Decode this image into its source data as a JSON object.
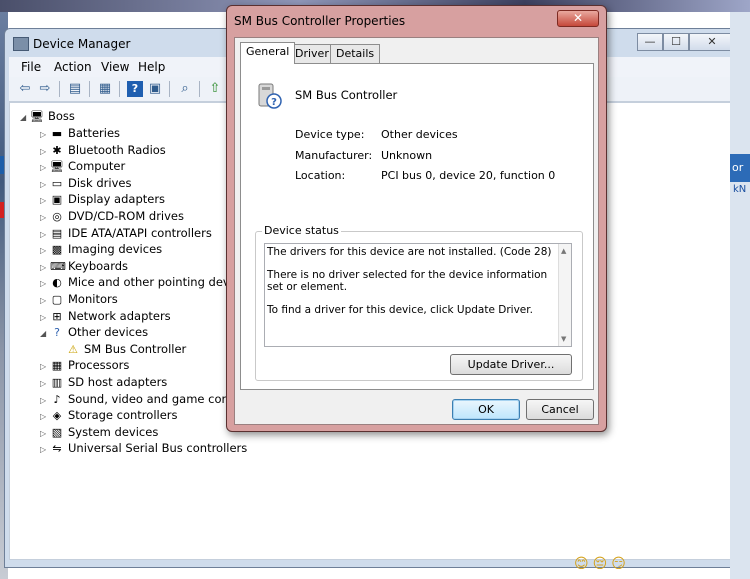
{
  "device_manager": {
    "title": "Device Manager",
    "controls": {
      "minimize": "—",
      "maximize": "☐",
      "close": "✕"
    },
    "menu": [
      "File",
      "Action",
      "View",
      "Help"
    ],
    "root": "Boss",
    "categories": [
      {
        "label": "Batteries",
        "icon": "battery-icon",
        "glyph": "▬"
      },
      {
        "label": "Bluetooth Radios",
        "icon": "bluetooth-icon",
        "glyph": "✱"
      },
      {
        "label": "Computer",
        "icon": "computer-icon",
        "glyph": "🖥"
      },
      {
        "label": "Disk drives",
        "icon": "disk-drive-icon",
        "glyph": "▭"
      },
      {
        "label": "Display adapters",
        "icon": "display-adapter-icon",
        "glyph": "▣"
      },
      {
        "label": "DVD/CD-ROM drives",
        "icon": "dvd-drive-icon",
        "glyph": "◎"
      },
      {
        "label": "IDE ATA/ATAPI controllers",
        "icon": "ide-controller-icon",
        "glyph": "▤"
      },
      {
        "label": "Imaging devices",
        "icon": "camera-icon",
        "glyph": "▩"
      },
      {
        "label": "Keyboards",
        "icon": "keyboard-icon",
        "glyph": "⌨"
      },
      {
        "label": "Mice and other pointing devices",
        "icon": "mouse-icon",
        "glyph": "◐"
      },
      {
        "label": "Monitors",
        "icon": "monitor-icon",
        "glyph": "▢"
      },
      {
        "label": "Network adapters",
        "icon": "network-adapter-icon",
        "glyph": "⊞"
      },
      {
        "label": "Other devices",
        "icon": "unknown-device-icon",
        "glyph": "?"
      },
      {
        "label": "SM Bus Controller",
        "icon": "warning-device-icon",
        "glyph": "⚠"
      },
      {
        "label": "Processors",
        "icon": "processor-icon",
        "glyph": "▦"
      },
      {
        "label": "SD host adapters",
        "icon": "sd-card-icon",
        "glyph": "▥"
      },
      {
        "label": "Sound, video and game controllers",
        "icon": "speaker-icon",
        "glyph": "♪"
      },
      {
        "label": "Storage controllers",
        "icon": "storage-icon",
        "glyph": "◈"
      },
      {
        "label": "System devices",
        "icon": "system-device-icon",
        "glyph": "▧"
      },
      {
        "label": "Universal Serial Bus controllers",
        "icon": "usb-icon",
        "glyph": "⇋"
      }
    ]
  },
  "dialog": {
    "title": "SM Bus Controller Properties",
    "close": "✕",
    "tabs": [
      "General",
      "Driver",
      "Details"
    ],
    "device_name": "SM Bus Controller",
    "fields": {
      "device_type_label": "Device type:",
      "device_type_value": "Other devices",
      "manufacturer_label": "Manufacturer:",
      "manufacturer_value": "Unknown",
      "location_label": "Location:",
      "location_value": "PCI bus 0, device 20, function 0"
    },
    "status_group_title": "Device status",
    "status_lines": [
      "The drivers for this device are not installed. (Code 28)",
      "There is no driver selected for the device information set or element.",
      "To find a driver for this device, click Update Driver."
    ],
    "update_driver_button": "Update Driver...",
    "ok_button": "OK",
    "cancel_button": "Cancel"
  },
  "background": {
    "emojis": "😊😔😏"
  }
}
